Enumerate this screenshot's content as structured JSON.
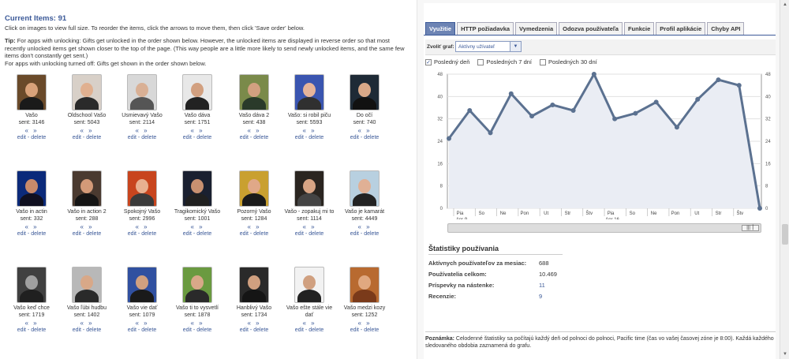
{
  "left": {
    "title": "Current Items: 91",
    "intro": "Click on images to view full size. To reorder the items, click the arrows to move them, then click 'Save order' below.",
    "tip_label": "Tip:",
    "tip_text": " For apps with unlocking: Gifts get unlocked in the order shown below. However, the unlocked items are displayed in reverse order so that most recently unlocked items get shown closer to the top of the page. (This way people are a little more likely to send newly unlocked items, and the same few items don't constantly get sent.)",
    "tip_text2": "For apps with unlocking turned off: Gifts get shown in the order shown below.",
    "arrows": "« »",
    "edit": "edit",
    "sep": " - ",
    "delete": "delete",
    "items": [
      {
        "name": "Vašo",
        "sent": "sent: 3146",
        "bg": "#6a4a2a",
        "skin": "#d9a27a",
        "shirt": "#1a1a1a"
      },
      {
        "name": "Oldschool Vašo",
        "sent": "sent: 5043",
        "bg": "#d8d0c8",
        "skin": "#e0b090",
        "shirt": "#2a2a2a"
      },
      {
        "name": "Usmievavý Vašo",
        "sent": "sent: 2114",
        "bg": "#d8d8d8",
        "skin": "#d9b095",
        "shirt": "#555555"
      },
      {
        "name": "Vašo dáva",
        "sent": "sent: 1751",
        "bg": "#e8e8e8",
        "skin": "#d2a080",
        "shirt": "#222222"
      },
      {
        "name": "Vašo dáva 2",
        "sent": "sent: 438",
        "bg": "#7a8a4a",
        "skin": "#d2a080",
        "shirt": "#2a3a2a"
      },
      {
        "name": "Vašo: si robil piču",
        "sent": "sent: 5593",
        "bg": "#3a55b0",
        "skin": "#e6b49a",
        "shirt": "#303030"
      },
      {
        "name": "Do očí",
        "sent": "sent: 740",
        "bg": "#1e2a36",
        "skin": "#d8a888",
        "shirt": "#111111"
      },
      {
        "name": "Vašo in actin",
        "sent": "sent: 332",
        "bg": "#0b2a7a",
        "skin": "#c88a6a",
        "shirt": "#101020"
      },
      {
        "name": "Vašo in action 2",
        "sent": "sent: 288",
        "bg": "#4a3a30",
        "skin": "#d39a78",
        "shirt": "#151515"
      },
      {
        "name": "Spokojný Vašo",
        "sent": "sent: 2996",
        "bg": "#c8451e",
        "skin": "#e8b090",
        "shirt": "#3a3a3a"
      },
      {
        "name": "Tragikomický Vašo",
        "sent": "sent: 1001",
        "bg": "#1a2030",
        "skin": "#c89070",
        "shirt": "#202020"
      },
      {
        "name": "Pozorný Vašo",
        "sent": "sent: 1284",
        "bg": "#c9a030",
        "skin": "#e0a888",
        "shirt": "#1a1a1a"
      },
      {
        "name": "Vašo - zopakuj mi to",
        "sent": "sent: 1114",
        "bg": "#2a2520",
        "skin": "#d8a585",
        "shirt": "#444444"
      },
      {
        "name": "Vašo je kamarát",
        "sent": "sent: 4449",
        "bg": "#b8d0e0",
        "skin": "#e0b095",
        "shirt": "#222222"
      },
      {
        "name": "Vašo keď chce",
        "sent": "sent: 1719",
        "bg": "#404040",
        "skin": "#a0a0a0",
        "shirt": "#202020"
      },
      {
        "name": "Vašo ľúbi hudbu",
        "sent": "sent: 1402",
        "bg": "#b8b8b8",
        "skin": "#d8a888",
        "shirt": "#2a2a2a"
      },
      {
        "name": "Vašo vie dať",
        "sent": "sent: 1079",
        "bg": "#3050a0",
        "skin": "#d0a080",
        "shirt": "#1a1a1a"
      },
      {
        "name": "Vašo ti to vysvetlí",
        "sent": "sent: 1878",
        "bg": "#6a9a40",
        "skin": "#d8a888",
        "shirt": "#2a2a2a"
      },
      {
        "name": "Hanblivý Vašo",
        "sent": "sent: 1734",
        "bg": "#2a2a2a",
        "skin": "#d0a080",
        "shirt": "#151515"
      },
      {
        "name": "Vašo ešte stále vie dať",
        "sent": "",
        "bg": "#f2f2f2",
        "skin": "#d0a080",
        "shirt": "#222222"
      },
      {
        "name": "Vašo medzi kozy",
        "sent": "sent: 1252",
        "bg": "#b86a30",
        "skin": "#e0a880",
        "shirt": "#7a3a1a"
      }
    ]
  },
  "right": {
    "tabs": [
      "Využitie",
      "HTTP požiadavka",
      "Vymedzenia",
      "Odozva používateľa",
      "Funkcie",
      "Profil aplikácie",
      "Chyby API"
    ],
    "graph_label": "Zvoliť graf:",
    "graph_select": "Aktívny užívateľ",
    "checks": [
      {
        "label": "Posledný deň",
        "checked": true
      },
      {
        "label": "Posledných 7 dní",
        "checked": false
      },
      {
        "label": "Posledných 30 dní",
        "checked": false
      }
    ],
    "stats_title": "Štatistiky používania",
    "stats": [
      {
        "k": "Aktívnych používateľov za mesiac:",
        "v": "688",
        "link": false
      },
      {
        "k": "Používatelia celkom:",
        "v": "10.469",
        "link": false
      },
      {
        "k": "Príspevky na nástenke:",
        "v": "11",
        "link": true
      },
      {
        "k": "Recenzie:",
        "v": "9",
        "link": true
      }
    ],
    "note_label": "Poznámka:",
    "note_text": " Celodenné štatistiky sa počítajú každý deň od polnoci do polnoci, Pacific time (čas vo vašej časovej zóne je 8:00). Každá každého sledovaného obdobia zaznamená do grafu."
  },
  "chart_data": {
    "type": "area",
    "x": [
      "Pia",
      "So",
      "Ne",
      "Pon",
      "Ut",
      "Str",
      "Štv",
      "Pia",
      "So",
      "Ne",
      "Pon",
      "Ut",
      "Str",
      "Štv"
    ],
    "date_labels": [
      "Apr 9",
      "Apr 16"
    ],
    "values": [
      25,
      35,
      27,
      41,
      33,
      37,
      35,
      48,
      32,
      34,
      38,
      29,
      39,
      46,
      44,
      0
    ],
    "ylim": [
      0,
      48
    ],
    "yticks": [
      0,
      8,
      16,
      24,
      32,
      40,
      48
    ],
    "line_color": "#5b7190",
    "fill_color": "#eaedf4",
    "grid": true
  }
}
